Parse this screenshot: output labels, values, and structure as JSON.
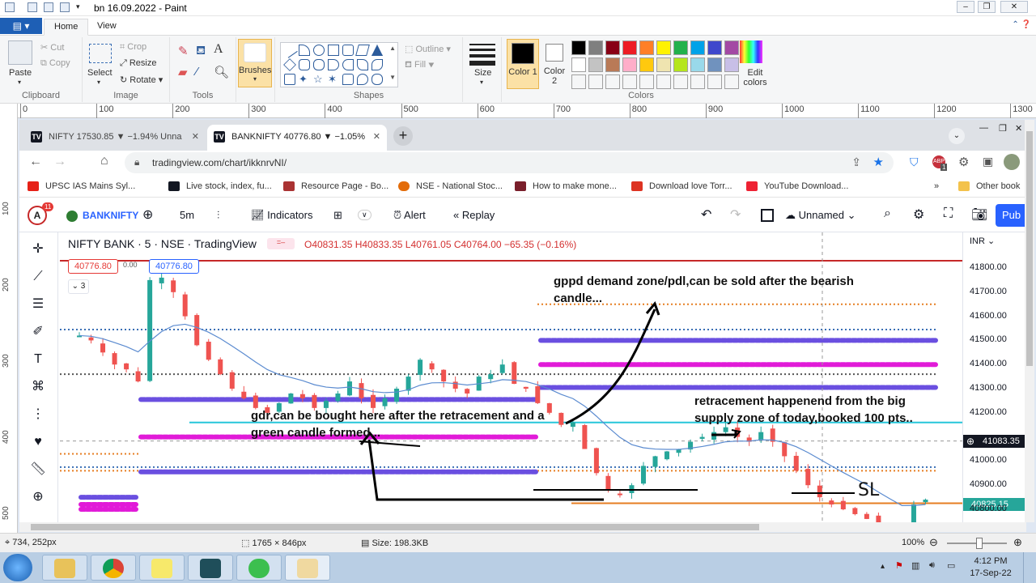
{
  "paint": {
    "title": "bn 16.09.2022 - Paint",
    "file_tab": "",
    "tabs": [
      "Home",
      "View"
    ],
    "clipboard": {
      "paste": "Paste",
      "cut": "Cut",
      "copy": "Copy",
      "label": "Clipboard"
    },
    "image": {
      "select": "Select",
      "crop": "Crop",
      "resize": "Resize",
      "rotate": "Rotate",
      "label": "Image"
    },
    "tools": {
      "label": "Tools"
    },
    "brushes": {
      "label": "Brushes"
    },
    "shapes": {
      "outline": "Outline",
      "fill": "Fill",
      "label": "Shapes"
    },
    "size": {
      "label": "Size"
    },
    "colors": {
      "color1": "Color 1",
      "color2": "Color 2",
      "edit": "Edit colors",
      "label": "Colors",
      "palette": [
        "#000000",
        "#7f7f7f",
        "#880015",
        "#ed1c24",
        "#ff7f27",
        "#fff200",
        "#22b14c",
        "#00a2e8",
        "#3f48cc",
        "#a349a4",
        "#ffffff",
        "#c3c3c3",
        "#b97a57",
        "#ffaec9",
        "#ffc90e",
        "#efe4b0",
        "#b5e61d",
        "#99d9ea",
        "#7092be",
        "#c8bfe7"
      ]
    },
    "ruler_h": [
      "0",
      "100",
      "200",
      "300",
      "400",
      "500",
      "600",
      "700",
      "800",
      "900",
      "1000",
      "1100",
      "1200",
      "1300"
    ],
    "ruler_v": [
      "100",
      "200",
      "300",
      "400",
      "500"
    ],
    "status": {
      "cursor": "734, 252px",
      "selection": "1765 × 846px",
      "size": "Size: 198.3KB",
      "zoom": "100%"
    }
  },
  "browser": {
    "tabs": [
      {
        "title": "NIFTY 17530.85 ▼ −1.94% Unna"
      },
      {
        "title": "BANKNIFTY 40776.80 ▼ −1.05%"
      }
    ],
    "url": "tradingview.com/chart/ikknrvNI/",
    "bookmarks": [
      "UPSC IAS Mains Syl...",
      "Live stock, index, fu...",
      "Resource Page - Bo...",
      "NSE - National Stoc...",
      "How to make mone...",
      "Download love Torr...",
      "YouTube Download..."
    ],
    "other_bookmarks": "Other book",
    "profile_badge": "1"
  },
  "tv": {
    "alerts_badge": "11",
    "symbol": "BANKNIFTY",
    "interval": "5m",
    "indicators": "Indicators",
    "alert": "Alert",
    "replay": "Replay",
    "layout": "Unnamed",
    "publish": "Pub",
    "legend": {
      "title": "NIFTY BANK · 5 · NSE · TradingView",
      "ohlc": "O40831.35 H40833.35 L40761.05 C40764.00 −65.35 (−0.16%)"
    },
    "sell_price": "40776.80",
    "spread": "0.00",
    "buy_price": "40776.80",
    "indicator_count": "3",
    "currency": "INR",
    "price_labels": [
      "41800.00",
      "41700.00",
      "41600.00",
      "41500.00",
      "41400.00",
      "41300.00",
      "41200.00",
      "41083.35",
      "41000.00",
      "40900.00",
      "40825.15",
      "40800.00"
    ],
    "crosshair_price": "41083.35",
    "last_price": "40825.15",
    "annotations": {
      "demand": "gppd demand zone/pdl,can be sold after the bearish candle...",
      "retrace": "retracement happenend from the big supply zone of today,booked 100 pts..",
      "gdr": "gdr,can be bought here after the retracement and a green candle formed...",
      "sl": "SL"
    }
  },
  "taskbar": {
    "time": "4:12 PM",
    "date": "17-Sep-22"
  }
}
